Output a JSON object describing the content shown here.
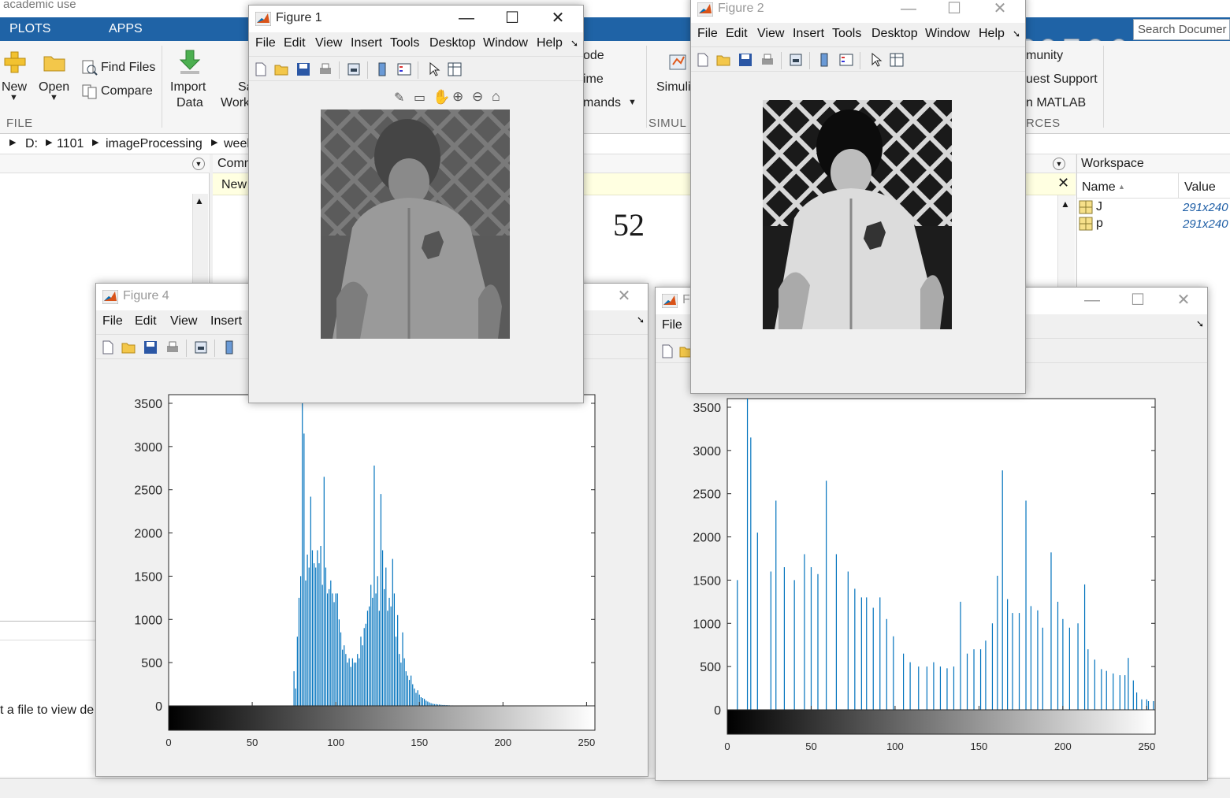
{
  "desktop": {
    "title_fragment": "academic use",
    "tabs": [
      "PLOTS",
      "APPS"
    ],
    "quick_search_placeholder": "Search Documer",
    "ribbon": {
      "new_label": "New",
      "open_label": "Open",
      "find_files_label": "Find Files",
      "compare_label": "Compare",
      "import_data_label_1": "Import",
      "import_data_label_2": "Data",
      "save_workspace_label_1": "Sa",
      "save_workspace_label_2": "Work",
      "file_section": "FILE",
      "code_fragment": "ode",
      "time_fragment": "ime",
      "commands_fragment": "mands",
      "simulink_label": "Simuli",
      "simulink_section": "SIMUL",
      "community_fragment": "munity",
      "request_support_fragment": "uest Support",
      "learn_matlab_fragment": "n MATLAB",
      "resources_section": "RCES"
    },
    "address": [
      "D:",
      "1101",
      "imageProcessing",
      "weel"
    ],
    "command_window": {
      "title_fragment": "Comm",
      "new_bar_fragment": "New",
      "output_value": "52"
    },
    "current_folder_hint": "t a file to view de",
    "workspace": {
      "title": "Workspace",
      "col_name": "Name",
      "col_value": "Value",
      "rows": [
        {
          "name": "J",
          "value": "291x240"
        },
        {
          "name": "p",
          "value": "291x240"
        }
      ]
    }
  },
  "figures": {
    "fig1": {
      "title": "Figure 1",
      "menu": [
        "File",
        "Edit",
        "View",
        "Insert",
        "Tools",
        "Desktop",
        "Window",
        "Help"
      ]
    },
    "fig2": {
      "title": "Figure 2",
      "menu": [
        "File",
        "Edit",
        "View",
        "Insert",
        "Tools",
        "Desktop",
        "Window",
        "Help"
      ]
    },
    "fig4": {
      "title": "Figure 4",
      "menu": [
        "File",
        "Edit",
        "View",
        "Insert"
      ]
    },
    "fig3": {
      "title_fragment": "Fi",
      "menu": [
        "File"
      ]
    }
  },
  "chart_data": [
    {
      "type": "bar",
      "title": "",
      "xlabel": "",
      "ylabel": "",
      "xlim": [
        0,
        255
      ],
      "ylim": [
        0,
        3600
      ],
      "xticks": [
        0,
        50,
        100,
        150,
        200,
        250
      ],
      "yticks": [
        0,
        500,
        1000,
        1500,
        2000,
        2500,
        3000,
        3500
      ],
      "colorbar": "gray",
      "bar_color": "#0072bd",
      "x": [
        75,
        76,
        77,
        78,
        79,
        80,
        81,
        82,
        83,
        84,
        85,
        86,
        87,
        88,
        89,
        90,
        91,
        92,
        93,
        94,
        95,
        96,
        97,
        98,
        99,
        100,
        101,
        102,
        103,
        104,
        105,
        106,
        107,
        108,
        109,
        110,
        111,
        112,
        113,
        114,
        115,
        116,
        117,
        118,
        119,
        120,
        121,
        122,
        123,
        124,
        125,
        126,
        127,
        128,
        129,
        130,
        131,
        132,
        133,
        134,
        135,
        136,
        137,
        138,
        139,
        140,
        141,
        142,
        143,
        144,
        145,
        146,
        147,
        148,
        149,
        150,
        151,
        152,
        153,
        154,
        155,
        156,
        157,
        158,
        159,
        160,
        161,
        162,
        163,
        164,
        165,
        166,
        167,
        168,
        169,
        170,
        175,
        180,
        185,
        190,
        200,
        210
      ],
      "values": [
        400,
        200,
        800,
        1250,
        1500,
        3600,
        3150,
        1450,
        1750,
        1600,
        2420,
        1800,
        1650,
        1600,
        1800,
        1650,
        1850,
        1400,
        2650,
        1600,
        1300,
        1350,
        1450,
        1300,
        1200,
        1300,
        1300,
        1000,
        850,
        650,
        700,
        600,
        500,
        550,
        450,
        550,
        500,
        500,
        600,
        550,
        800,
        700,
        900,
        950,
        1100,
        1150,
        1400,
        1250,
        2780,
        1300,
        1500,
        1100,
        2450,
        1800,
        1350,
        1600,
        1100,
        1250,
        1150,
        1700,
        1300,
        800,
        1050,
        600,
        500,
        850,
        550,
        400,
        350,
        300,
        350,
        250,
        200,
        150,
        180,
        130,
        100,
        90,
        80,
        60,
        50,
        40,
        30,
        25,
        20,
        20,
        15,
        15,
        12,
        10,
        10,
        8,
        8,
        6,
        5,
        5,
        4,
        3,
        3,
        3,
        2,
        2
      ]
    },
    {
      "type": "bar",
      "title": "",
      "xlabel": "",
      "ylabel": "",
      "xlim": [
        0,
        255
      ],
      "ylim": [
        0,
        3600
      ],
      "xticks": [
        0,
        50,
        100,
        150,
        200,
        250
      ],
      "yticks": [
        0,
        500,
        1000,
        1500,
        2000,
        2500,
        3000,
        3500
      ],
      "colorbar": "gray",
      "bar_color": "#0072bd",
      "x": [
        6,
        12,
        14,
        18,
        26,
        29,
        34,
        40,
        46,
        50,
        54,
        59,
        65,
        72,
        76,
        80,
        83,
        87,
        91,
        95,
        99,
        105,
        109,
        114,
        119,
        123,
        127,
        131,
        135,
        139,
        143,
        147,
        151,
        154,
        158,
        161,
        164,
        167,
        170,
        174,
        178,
        181,
        185,
        188,
        193,
        197,
        200,
        204,
        209,
        213,
        215,
        219,
        223,
        226,
        230,
        234,
        237,
        239,
        242,
        244,
        247,
        250,
        251,
        254
      ],
      "values": [
        1500,
        3600,
        3150,
        2050,
        1600,
        2420,
        1650,
        1500,
        1800,
        1650,
        1570,
        2650,
        1800,
        1600,
        1400,
        1300,
        1300,
        1180,
        1300,
        1050,
        850,
        650,
        550,
        500,
        500,
        550,
        500,
        480,
        500,
        1250,
        650,
        700,
        700,
        800,
        1000,
        1550,
        2770,
        1280,
        1120,
        1120,
        2420,
        1200,
        1150,
        950,
        1820,
        1250,
        1050,
        950,
        1000,
        1450,
        700,
        580,
        470,
        450,
        420,
        400,
        400,
        600,
        340,
        200,
        120,
        120,
        100,
        100
      ]
    }
  ]
}
